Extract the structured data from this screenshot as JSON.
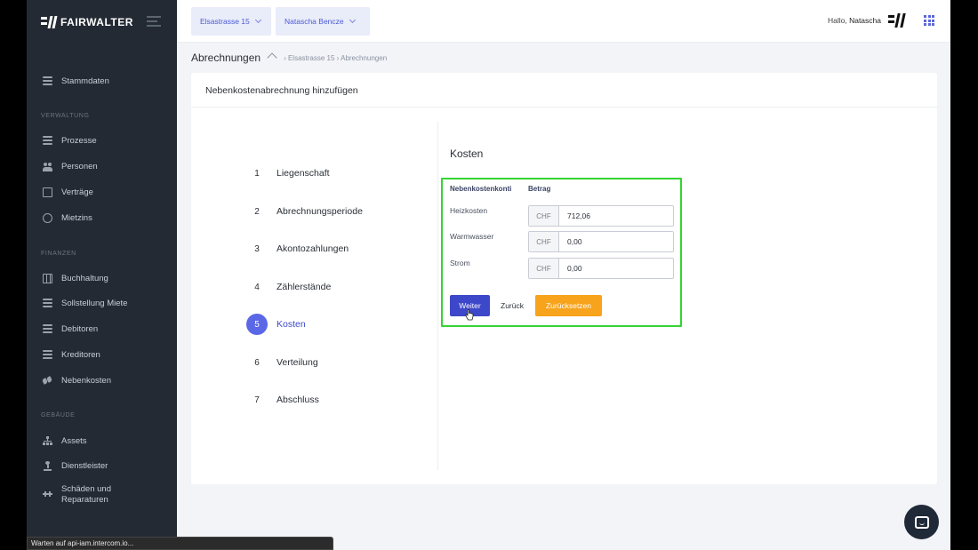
{
  "brand": {
    "name": "FAIRWALTER"
  },
  "topbar": {
    "property": "Elsastrasse 15",
    "user_select": "Natascha Bencze",
    "greeting": "Hallo,",
    "user_name": "Natascha"
  },
  "sidebar": {
    "item_stammdaten": "Stammdaten",
    "section_verwaltung": "VERWALTUNG",
    "item_prozesse": "Prozesse",
    "item_personen": "Personen",
    "item_vertraege": "Verträge",
    "item_mietzins": "Mietzins",
    "section_finanzen": "FINANZEN",
    "item_buchhaltung": "Buchhaltung",
    "item_sollstellung": "Sollstellung Miete",
    "item_debitoren": "Debitoren",
    "item_kreditoren": "Kreditoren",
    "item_nebenkosten": "Nebenkosten",
    "section_gebaeude": "GEBÄUDE",
    "item_assets": "Assets",
    "item_dienstleister": "Dienstleister",
    "item_schaeden_1": "Schäden und",
    "item_schaeden_2": "Reparaturen"
  },
  "breadcrumb": {
    "page_title": "Abrechnungen",
    "path": "› Elsastrasse 15 › Abrechnungen"
  },
  "card": {
    "title": "Nebenkostenabrechnung hinzufügen"
  },
  "steps": [
    {
      "num": "1",
      "label": "Liegenschaft"
    },
    {
      "num": "2",
      "label": "Abrechnungsperiode"
    },
    {
      "num": "3",
      "label": "Akontozahlungen"
    },
    {
      "num": "4",
      "label": "Zählerstände"
    },
    {
      "num": "5",
      "label": "Kosten",
      "active": true
    },
    {
      "num": "6",
      "label": "Verteilung"
    },
    {
      "num": "7",
      "label": "Abschluss"
    }
  ],
  "kosten": {
    "title": "Kosten",
    "col_konti": "Nebenkostenkonti",
    "col_betrag": "Betrag",
    "currency": "CHF",
    "rows": [
      {
        "label": "Heizkosten",
        "value": "712,06"
      },
      {
        "label": "Warmwasser",
        "value": "0,00"
      },
      {
        "label": "Strom",
        "value": "0,00"
      }
    ],
    "btn_next": "Weiter",
    "btn_back": "Zurück",
    "btn_reset": "Zurücksetzen"
  },
  "browser": {
    "status": "Warten auf api-iam.intercom.io..."
  },
  "colors": {
    "sidebar": "#232a33",
    "accent": "#3d47c9",
    "warning": "#f7a31c",
    "highlight": "#35d431"
  }
}
